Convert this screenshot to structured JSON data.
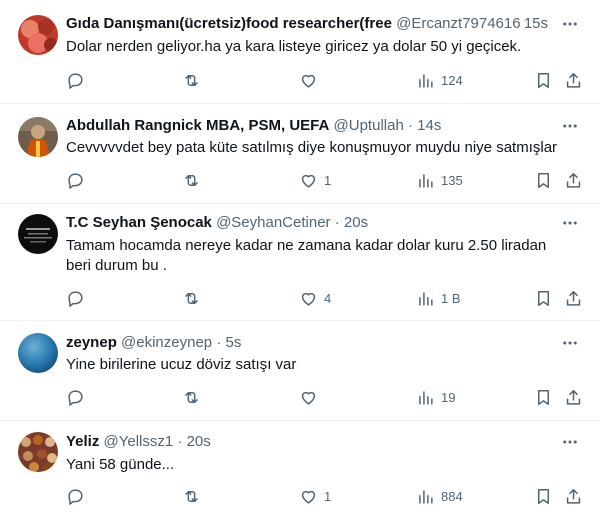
{
  "tweets": [
    {
      "name": "Gıda Danışmanı(ücretsiz)food researcher(free",
      "handle": "@Ercanzt7974616",
      "time": "15s",
      "text": "Dolar nerden geliyor.ha ya kara listeye giricez ya dolar 50 yi geçicek.",
      "replies": "",
      "retweets": "",
      "likes": "",
      "views": "124",
      "avatar_colors": [
        "#b03a2e",
        "#e8826a"
      ]
    },
    {
      "name": "Abdullah Rangnick MBA, PSM, UEFA",
      "handle": "@Uptullah",
      "time": "14s",
      "text": "Cevvvvvdet bey pata küte satılmış diye konuşmuyor muydu niye satmışlar",
      "replies": "",
      "retweets": "",
      "likes": "1",
      "views": "135",
      "avatar_colors": [
        "#5a4a3a",
        "#d35400"
      ]
    },
    {
      "name": "T.C Seyhan Şenocak",
      "handle": "@SeyhanCetiner",
      "time": "20s",
      "text": "Tamam hocamda nereye kadar ne zamana kadar dolar kuru 2.50 liradan beri durum bu .",
      "replies": "",
      "retweets": "",
      "likes": "4",
      "views": "1 B",
      "avatar_colors": [
        "#111111",
        "#444444"
      ]
    },
    {
      "name": "zeynep",
      "handle": "@ekinzeynep",
      "time": "5s",
      "text": "Yine birilerine ucuz döviz satışı var",
      "replies": "",
      "retweets": "",
      "likes": "",
      "views": "19",
      "avatar_colors": [
        "#1f6fa0",
        "#7fb6d6"
      ]
    },
    {
      "name": "Yeliz",
      "handle": "@Yellssz1",
      "time": "20s",
      "text": "Yani 58 günde...",
      "replies": "",
      "retweets": "",
      "likes": "1",
      "views": "884",
      "avatar_colors": [
        "#8e3b2f",
        "#d4a373"
      ]
    }
  ]
}
